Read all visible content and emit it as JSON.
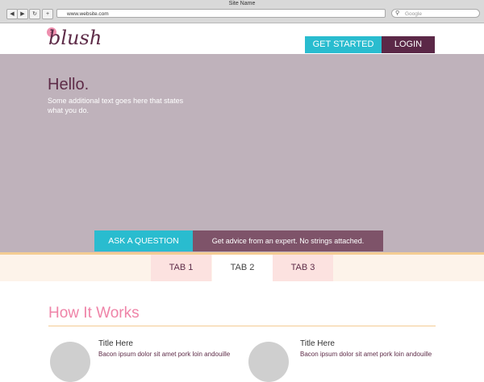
{
  "browser": {
    "title": "Site Name",
    "url": "www.website.com",
    "search_placeholder": "Google",
    "back_icon": "◀",
    "forward_icon": "▶",
    "reload_icon": "↻",
    "add_icon": "+",
    "search_icon": "⚲"
  },
  "header": {
    "logo_text": "blush",
    "logo_badge": "1",
    "get_started_label": "GET STARTED",
    "login_label": "LOGIN"
  },
  "hero": {
    "heading": "Hello.",
    "text": "Some additional text goes here that states what you do.",
    "question_label": "ASK A QUESTION",
    "advice_text": "Get advice from an expert. No strings attached."
  },
  "tabs": [
    "TAB 1",
    "TAB 2",
    "TAB 3"
  ],
  "how_it_works": {
    "heading": "How It Works",
    "cards": [
      {
        "title": "Title Here",
        "text": "Bacon ipsum dolor sit amet pork loin andouille"
      },
      {
        "title": "Title Here",
        "text": "Bacon ipsum dolor sit amet pork loin andouille"
      }
    ]
  },
  "colors": {
    "accent_teal": "#29bccf",
    "brand_plum": "#5b2847",
    "hero_bg": "#bfb2bb",
    "pink_heading": "#ef84a8"
  }
}
